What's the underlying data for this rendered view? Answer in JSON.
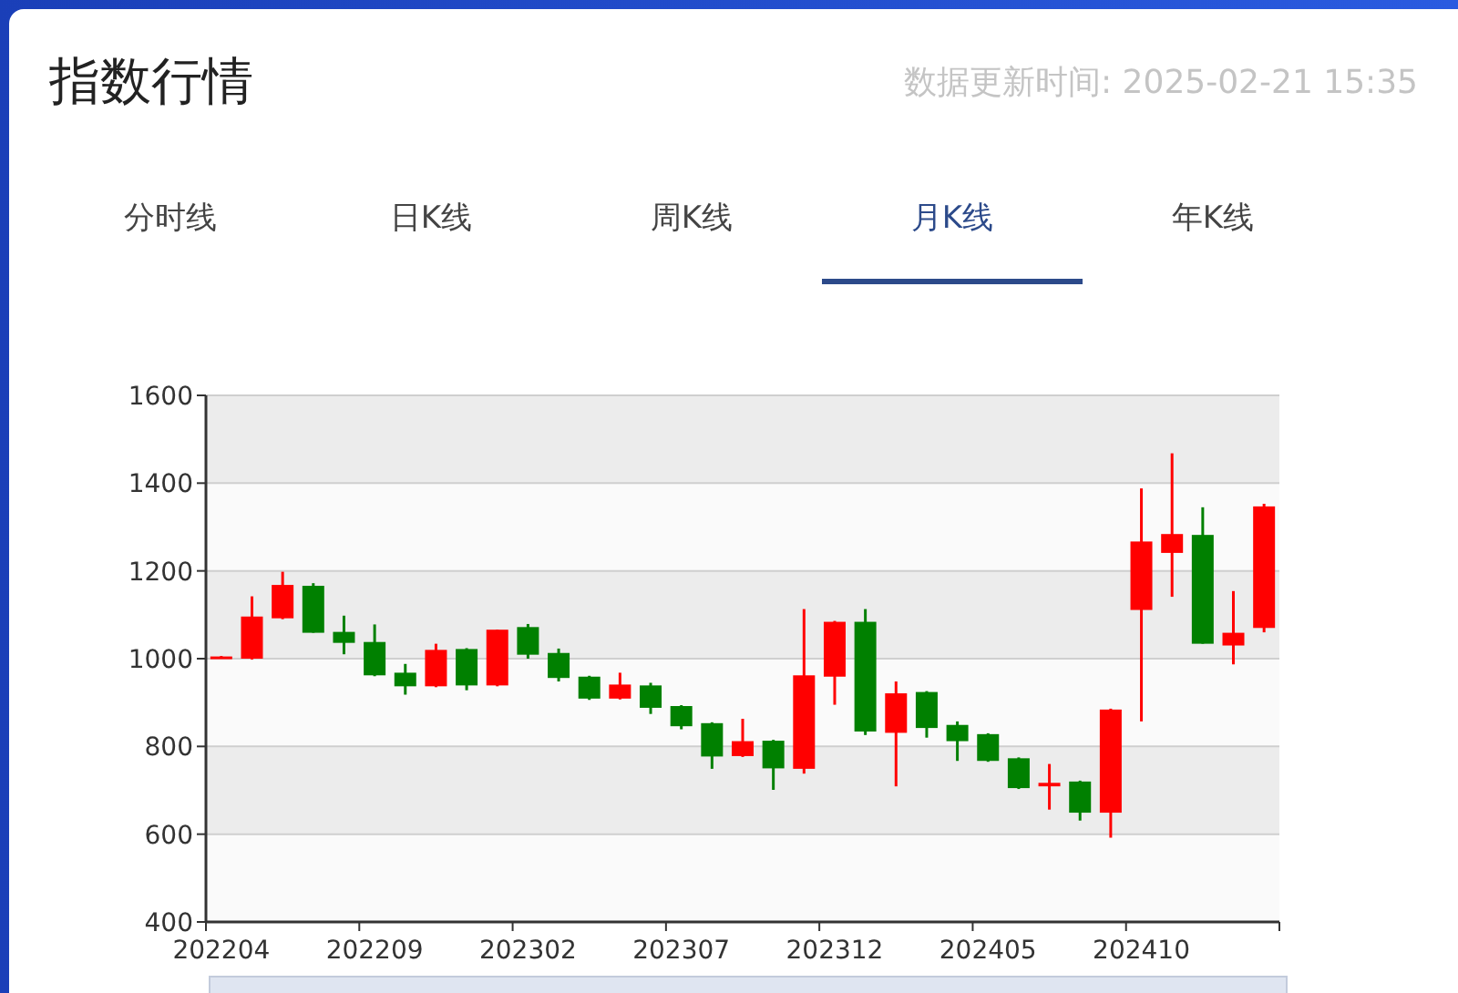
{
  "header": {
    "title": "指数行情",
    "update_time": "数据更新时间: 2025-02-21 15:35"
  },
  "tabs": [
    {
      "label": "分时线",
      "selected": false
    },
    {
      "label": "日K线",
      "selected": false
    },
    {
      "label": "周K线",
      "selected": false
    },
    {
      "label": "月K线",
      "selected": true
    },
    {
      "label": "年K线",
      "selected": false
    }
  ],
  "chart": {
    "chart_data": {
      "type": "candlestick",
      "ylim": [
        400,
        1600
      ],
      "yticks": [
        400,
        600,
        800,
        1000,
        1200,
        1400,
        1600
      ],
      "grid": true,
      "categories": [
        "202204",
        null,
        null,
        null,
        null,
        "202209",
        null,
        null,
        null,
        null,
        "202302",
        null,
        null,
        null,
        null,
        "202307",
        null,
        null,
        null,
        null,
        "202312",
        null,
        null,
        null,
        null,
        "202405",
        null,
        null,
        null,
        null,
        "202410",
        null,
        null,
        null,
        null
      ],
      "ohlc": [
        [
          1000,
          1006,
          1000,
          1005
        ],
        [
          1000,
          1142,
          998,
          1096
        ],
        [
          1092,
          1198,
          1090,
          1168
        ],
        [
          1166,
          1172,
          1059,
          1059
        ],
        [
          1061,
          1098,
          1010,
          1036
        ],
        [
          1038,
          1078,
          960,
          962
        ],
        [
          968,
          988,
          918,
          937
        ],
        [
          937,
          1034,
          935,
          1020
        ],
        [
          1022,
          1024,
          928,
          939
        ],
        [
          939,
          1066,
          937,
          1066
        ],
        [
          1072,
          1079,
          1000,
          1009
        ],
        [
          1013,
          1023,
          948,
          956
        ],
        [
          959,
          961,
          906,
          909
        ],
        [
          909,
          968,
          907,
          941
        ],
        [
          939,
          945,
          874,
          888
        ],
        [
          892,
          894,
          839,
          846
        ],
        [
          853,
          855,
          749,
          777
        ],
        [
          778,
          863,
          776,
          812
        ],
        [
          813,
          815,
          701,
          750
        ],
        [
          749,
          1113,
          738,
          962
        ],
        [
          959,
          1086,
          895,
          1084
        ],
        [
          1084,
          1113,
          826,
          834
        ],
        [
          831,
          948,
          709,
          921
        ],
        [
          924,
          926,
          820,
          842
        ],
        [
          849,
          857,
          767,
          812
        ],
        [
          828,
          830,
          765,
          767
        ],
        [
          773,
          775,
          703,
          705
        ],
        [
          709,
          760,
          656,
          717
        ],
        [
          720,
          722,
          631,
          649
        ],
        [
          649,
          886,
          592,
          884
        ],
        [
          1111,
          1388,
          857,
          1267
        ],
        [
          1241,
          1468,
          1141,
          1284
        ],
        [
          1282,
          1345,
          1034,
          1034
        ],
        [
          1030,
          1154,
          987,
          1059
        ],
        [
          1070,
          1353,
          1060,
          1347
        ]
      ]
    }
  }
}
